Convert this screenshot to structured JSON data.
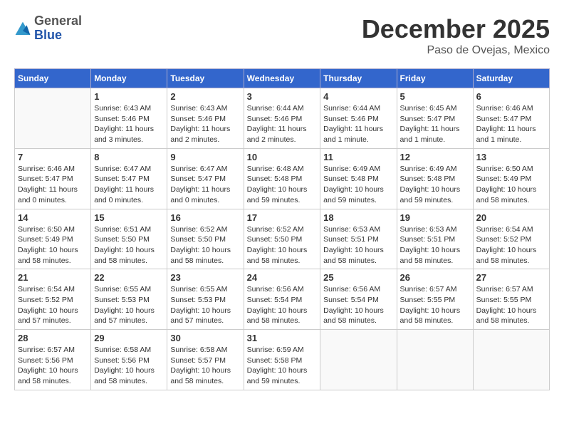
{
  "header": {
    "logo": {
      "general": "General",
      "blue": "Blue"
    },
    "title": "December 2025",
    "location": "Paso de Ovejas, Mexico"
  },
  "calendar": {
    "days_of_week": [
      "Sunday",
      "Monday",
      "Tuesday",
      "Wednesday",
      "Thursday",
      "Friday",
      "Saturday"
    ],
    "weeks": [
      [
        {
          "day": "",
          "info": ""
        },
        {
          "day": "1",
          "info": "Sunrise: 6:43 AM\nSunset: 5:46 PM\nDaylight: 11 hours\nand 3 minutes."
        },
        {
          "day": "2",
          "info": "Sunrise: 6:43 AM\nSunset: 5:46 PM\nDaylight: 11 hours\nand 2 minutes."
        },
        {
          "day": "3",
          "info": "Sunrise: 6:44 AM\nSunset: 5:46 PM\nDaylight: 11 hours\nand 2 minutes."
        },
        {
          "day": "4",
          "info": "Sunrise: 6:44 AM\nSunset: 5:46 PM\nDaylight: 11 hours\nand 1 minute."
        },
        {
          "day": "5",
          "info": "Sunrise: 6:45 AM\nSunset: 5:47 PM\nDaylight: 11 hours\nand 1 minute."
        },
        {
          "day": "6",
          "info": "Sunrise: 6:46 AM\nSunset: 5:47 PM\nDaylight: 11 hours\nand 1 minute."
        }
      ],
      [
        {
          "day": "7",
          "info": "Sunrise: 6:46 AM\nSunset: 5:47 PM\nDaylight: 11 hours\nand 0 minutes."
        },
        {
          "day": "8",
          "info": "Sunrise: 6:47 AM\nSunset: 5:47 PM\nDaylight: 11 hours\nand 0 minutes."
        },
        {
          "day": "9",
          "info": "Sunrise: 6:47 AM\nSunset: 5:47 PM\nDaylight: 11 hours\nand 0 minutes."
        },
        {
          "day": "10",
          "info": "Sunrise: 6:48 AM\nSunset: 5:48 PM\nDaylight: 10 hours\nand 59 minutes."
        },
        {
          "day": "11",
          "info": "Sunrise: 6:49 AM\nSunset: 5:48 PM\nDaylight: 10 hours\nand 59 minutes."
        },
        {
          "day": "12",
          "info": "Sunrise: 6:49 AM\nSunset: 5:48 PM\nDaylight: 10 hours\nand 59 minutes."
        },
        {
          "day": "13",
          "info": "Sunrise: 6:50 AM\nSunset: 5:49 PM\nDaylight: 10 hours\nand 58 minutes."
        }
      ],
      [
        {
          "day": "14",
          "info": "Sunrise: 6:50 AM\nSunset: 5:49 PM\nDaylight: 10 hours\nand 58 minutes."
        },
        {
          "day": "15",
          "info": "Sunrise: 6:51 AM\nSunset: 5:50 PM\nDaylight: 10 hours\nand 58 minutes."
        },
        {
          "day": "16",
          "info": "Sunrise: 6:52 AM\nSunset: 5:50 PM\nDaylight: 10 hours\nand 58 minutes."
        },
        {
          "day": "17",
          "info": "Sunrise: 6:52 AM\nSunset: 5:50 PM\nDaylight: 10 hours\nand 58 minutes."
        },
        {
          "day": "18",
          "info": "Sunrise: 6:53 AM\nSunset: 5:51 PM\nDaylight: 10 hours\nand 58 minutes."
        },
        {
          "day": "19",
          "info": "Sunrise: 6:53 AM\nSunset: 5:51 PM\nDaylight: 10 hours\nand 58 minutes."
        },
        {
          "day": "20",
          "info": "Sunrise: 6:54 AM\nSunset: 5:52 PM\nDaylight: 10 hours\nand 58 minutes."
        }
      ],
      [
        {
          "day": "21",
          "info": "Sunrise: 6:54 AM\nSunset: 5:52 PM\nDaylight: 10 hours\nand 57 minutes."
        },
        {
          "day": "22",
          "info": "Sunrise: 6:55 AM\nSunset: 5:53 PM\nDaylight: 10 hours\nand 57 minutes."
        },
        {
          "day": "23",
          "info": "Sunrise: 6:55 AM\nSunset: 5:53 PM\nDaylight: 10 hours\nand 57 minutes."
        },
        {
          "day": "24",
          "info": "Sunrise: 6:56 AM\nSunset: 5:54 PM\nDaylight: 10 hours\nand 58 minutes."
        },
        {
          "day": "25",
          "info": "Sunrise: 6:56 AM\nSunset: 5:54 PM\nDaylight: 10 hours\nand 58 minutes."
        },
        {
          "day": "26",
          "info": "Sunrise: 6:57 AM\nSunset: 5:55 PM\nDaylight: 10 hours\nand 58 minutes."
        },
        {
          "day": "27",
          "info": "Sunrise: 6:57 AM\nSunset: 5:55 PM\nDaylight: 10 hours\nand 58 minutes."
        }
      ],
      [
        {
          "day": "28",
          "info": "Sunrise: 6:57 AM\nSunset: 5:56 PM\nDaylight: 10 hours\nand 58 minutes."
        },
        {
          "day": "29",
          "info": "Sunrise: 6:58 AM\nSunset: 5:56 PM\nDaylight: 10 hours\nand 58 minutes."
        },
        {
          "day": "30",
          "info": "Sunrise: 6:58 AM\nSunset: 5:57 PM\nDaylight: 10 hours\nand 58 minutes."
        },
        {
          "day": "31",
          "info": "Sunrise: 6:59 AM\nSunset: 5:58 PM\nDaylight: 10 hours\nand 59 minutes."
        },
        {
          "day": "",
          "info": ""
        },
        {
          "day": "",
          "info": ""
        },
        {
          "day": "",
          "info": ""
        }
      ]
    ]
  }
}
